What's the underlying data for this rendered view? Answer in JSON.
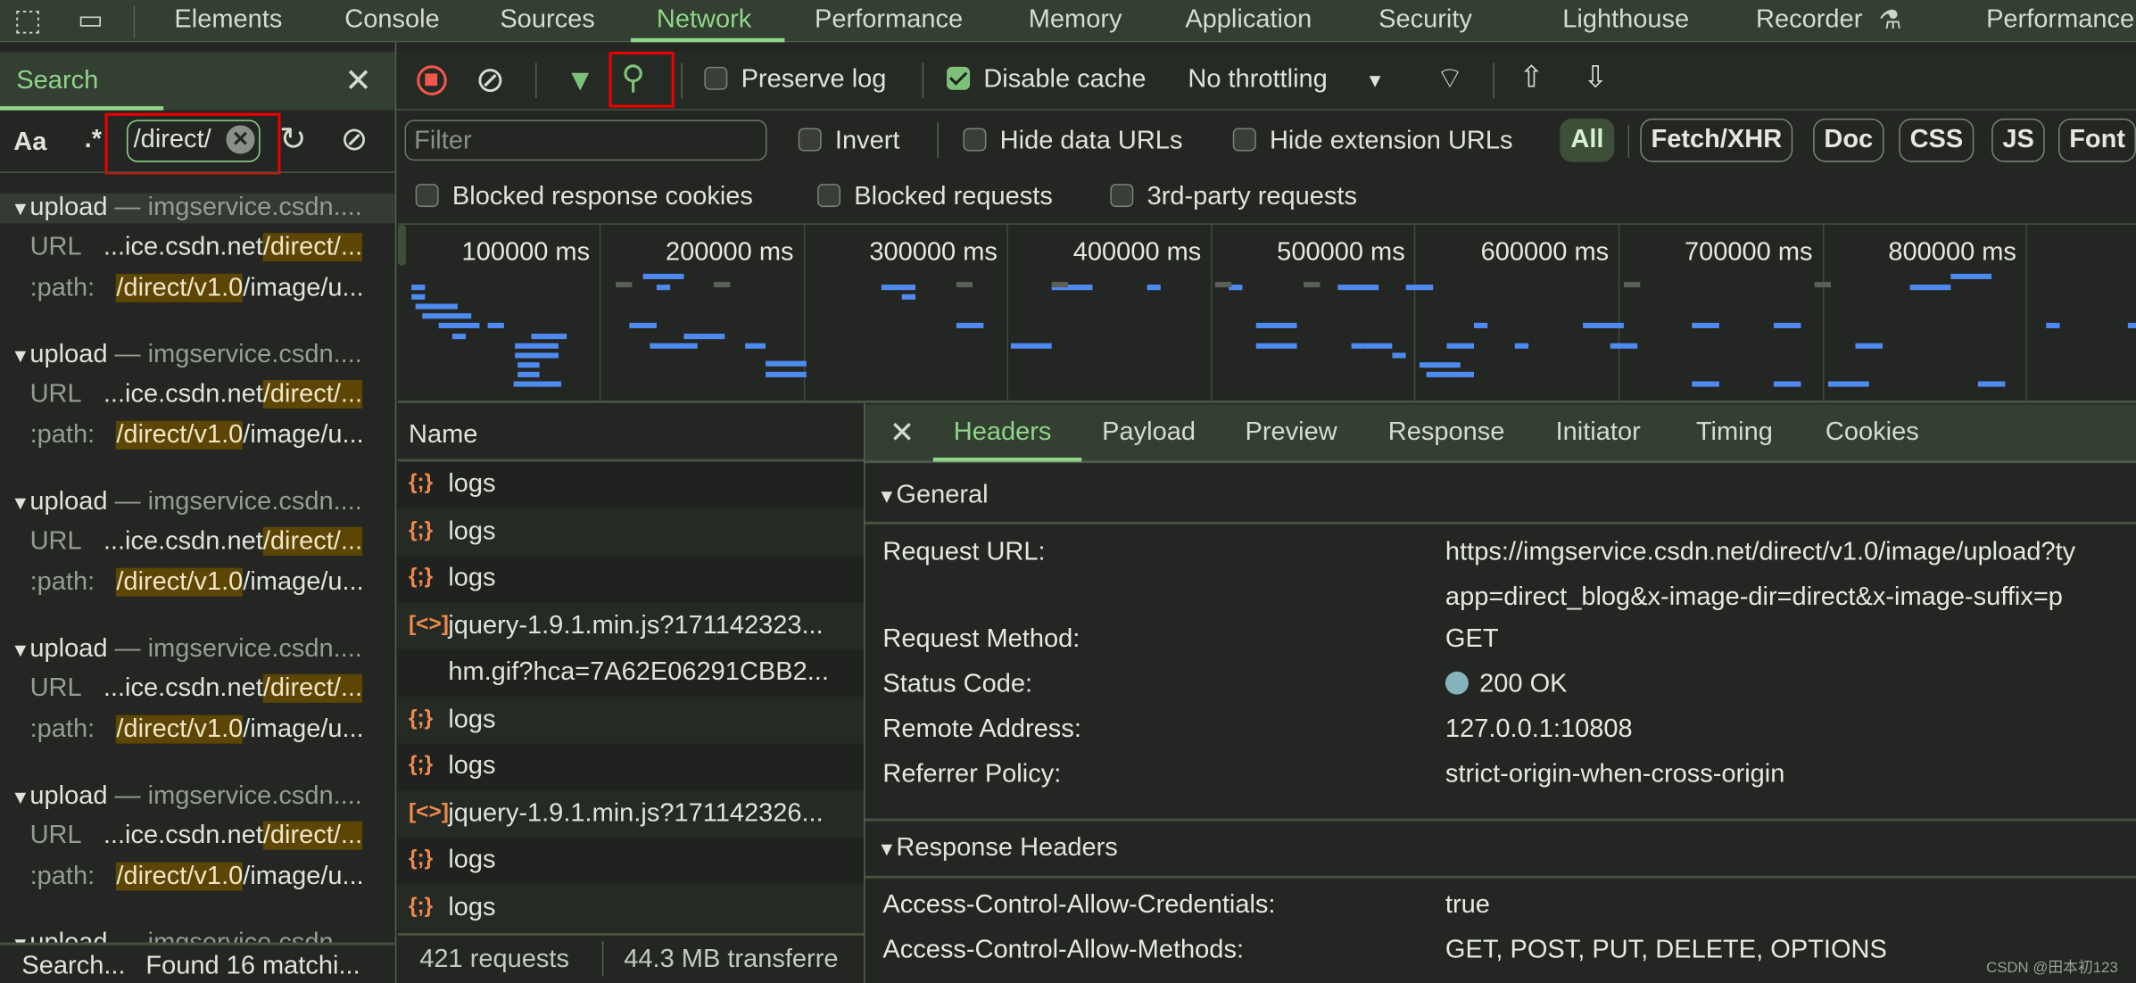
{
  "topbar": {
    "tabs": [
      "Elements",
      "Console",
      "Sources",
      "Network",
      "Performance",
      "Memory",
      "Application",
      "Security",
      "Lighthouse",
      "Recorder",
      "Performance"
    ],
    "active": "Network"
  },
  "search": {
    "title": "Search",
    "case_label": "Aa",
    "regex_label": ".*",
    "query": "/direct/",
    "results": [
      {
        "name": "upload",
        "host": "imgservice.csdn....",
        "url_label": "URL",
        "url_prefix": "...ice.csdn.net",
        "url_match": "/direct/...",
        "path_label": ":path:",
        "path_match": "/direct/v1.0",
        "path_rest": "/image/u..."
      },
      {
        "name": "upload",
        "host": "imgservice.csdn....",
        "url_label": "URL",
        "url_prefix": "...ice.csdn.net",
        "url_match": "/direct/...",
        "path_label": ":path:",
        "path_match": "/direct/v1.0",
        "path_rest": "/image/u..."
      },
      {
        "name": "upload",
        "host": "imgservice.csdn....",
        "url_label": "URL",
        "url_prefix": "...ice.csdn.net",
        "url_match": "/direct/...",
        "path_label": ":path:",
        "path_match": "/direct/v1.0",
        "path_rest": "/image/u..."
      },
      {
        "name": "upload",
        "host": "imgservice.csdn....",
        "url_label": "URL",
        "url_prefix": "...ice.csdn.net",
        "url_match": "/direct/...",
        "path_label": ":path:",
        "path_match": "/direct/v1.0",
        "path_rest": "/image/u..."
      },
      {
        "name": "upload",
        "host": "imgservice.csdn....",
        "url_label": "URL",
        "url_prefix": "...ice.csdn.net",
        "url_match": "/direct/...",
        "path_label": ":path:",
        "path_match": "/direct/v1.0",
        "path_rest": "/image/u..."
      },
      {
        "name": "upload",
        "host": "imgservice.csdn....",
        "url_label": "",
        "url_prefix": "",
        "url_match": "",
        "path_label": "",
        "path_match": "",
        "path_rest": ""
      }
    ],
    "status": "Search...",
    "found": "Found 16 matchi..."
  },
  "toolbar": {
    "preserve_log": "Preserve log",
    "preserve_checked": false,
    "disable_cache": "Disable cache",
    "disable_checked": true,
    "throttling": "No throttling"
  },
  "filter": {
    "placeholder": "Filter",
    "invert": "Invert",
    "hide_data": "Hide data URLs",
    "hide_ext": "Hide extension URLs",
    "types": [
      "All",
      "Fetch/XHR",
      "Doc",
      "CSS",
      "JS",
      "Font"
    ],
    "active_type": "All",
    "blocked_cookies": "Blocked response cookies",
    "blocked_requests": "Blocked requests",
    "third_party": "3rd-party requests"
  },
  "overview": {
    "ticks": [
      "100000 ms",
      "200000 ms",
      "300000 ms",
      "400000 ms",
      "500000 ms",
      "600000 ms",
      "700000 ms",
      "800000 ms",
      "9000"
    ]
  },
  "requests": {
    "header": "Name",
    "rows": [
      {
        "icon": "fetch",
        "name": "logs"
      },
      {
        "icon": "fetch",
        "name": "logs"
      },
      {
        "icon": "fetch",
        "name": "logs"
      },
      {
        "icon": "script",
        "name": "jquery-1.9.1.min.js?171142323..."
      },
      {
        "icon": "none",
        "name": "hm.gif?hca=7A62E06291CBB2..."
      },
      {
        "icon": "fetch",
        "name": "logs"
      },
      {
        "icon": "fetch",
        "name": "logs"
      },
      {
        "icon": "script",
        "name": "jquery-1.9.1.min.js?171142326..."
      },
      {
        "icon": "fetch",
        "name": "logs"
      },
      {
        "icon": "fetch",
        "name": "logs"
      }
    ],
    "count": "421 requests",
    "transferred": "44.3 MB transferre"
  },
  "details": {
    "tabs": [
      "Headers",
      "Payload",
      "Preview",
      "Response",
      "Initiator",
      "Timing",
      "Cookies"
    ],
    "active": "Headers",
    "general_title": "General",
    "general": [
      {
        "k": "Request URL:",
        "v": "https://imgservice.csdn.net/direct/v1.0/image/upload?ty"
      },
      {
        "k": "",
        "v": "app=direct_blog&x-image-dir=direct&x-image-suffix=p"
      },
      {
        "k": "Request Method:",
        "v": "GET"
      },
      {
        "k": "Status Code:",
        "v": "200 OK"
      },
      {
        "k": "Remote Address:",
        "v": "127.0.0.1:10808"
      },
      {
        "k": "Referrer Policy:",
        "v": "strict-origin-when-cross-origin"
      }
    ],
    "status_color": "#86b3bb",
    "response_title": "Response Headers",
    "response": [
      {
        "k": "Access-Control-Allow-Credentials:",
        "v": "true"
      },
      {
        "k": "Access-Control-Allow-Methods:",
        "v": "GET, POST, PUT, DELETE, OPTIONS"
      }
    ]
  },
  "watermark": "CSDN @田本初123",
  "colors": {
    "accent": "#8fd48a",
    "highlight": "#5c4505",
    "bar": "#4e8af0",
    "record": "#f2574c"
  }
}
